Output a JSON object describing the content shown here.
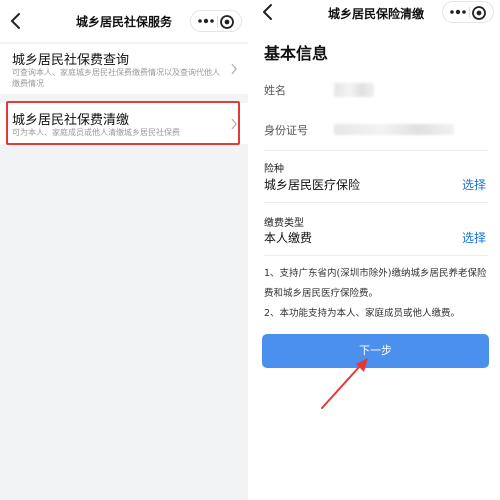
{
  "left_screen": {
    "title": "城乡居民社保服务",
    "items": [
      {
        "title": "城乡居民社保费查询",
        "desc": "可查询本人、家庭城乡居民社保费缴费情况以及查询代他人缴费情况"
      },
      {
        "title": "城乡居民社保费清缴",
        "desc": "可为本人、家庭成员或他人清缴城乡居民社保费"
      }
    ]
  },
  "right_screen": {
    "title": "城乡居民保险清缴",
    "section_title": "基本信息",
    "name_label": "姓名",
    "id_label": "身份证号",
    "insurance_label": "险种",
    "insurance_value": "城乡居民医疗保险",
    "payment_type_label": "缴费类型",
    "payment_type_value": "本人缴费",
    "select_label": "选择",
    "notes": [
      "1、支持广东省内(深圳市除外)缴纳城乡居民养老保险费和城乡居民医疗保险费。",
      "2、本功能支持为本人、家庭成员或他人缴费。"
    ],
    "next_button": "下一步"
  },
  "colors": {
    "accent_blue": "#4a90ec",
    "link_blue": "#1a73e8",
    "highlight_red": "#e53935"
  },
  "icons": [
    "back-arrow-icon",
    "more-dots-icon",
    "target-circle-icon",
    "chevron-right-icon"
  ]
}
